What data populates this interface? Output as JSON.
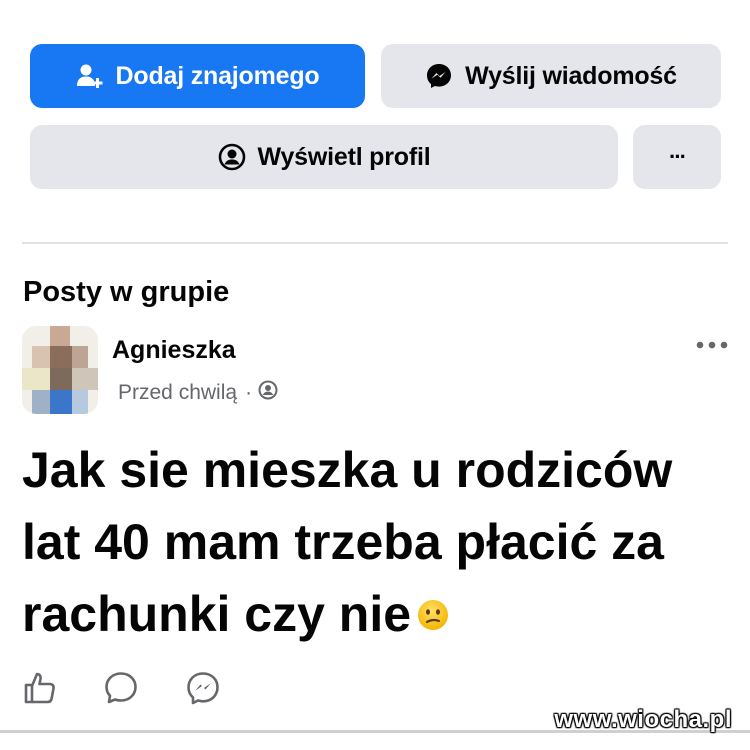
{
  "profile_actions": {
    "add_friend_label": "Dodaj znajomego",
    "message_label": "Wyślij wiadomość",
    "view_profile_label": "Wyświetl profil",
    "more_label": "···"
  },
  "section": {
    "title": "Posty w grupie"
  },
  "post": {
    "author": "Agnieszka",
    "time": "Przed chwilą",
    "separator": "·",
    "text": "Jak sie mieszka u rodziców lat 40 mam trzeba płacić za rachunki czy nie",
    "emoji": "confused-face-emoji"
  },
  "actions": {
    "like": "like-icon",
    "comment": "comment-icon",
    "share": "messenger-share-icon"
  },
  "watermark": "www.wiocha.pl",
  "colors": {
    "primary": "#1877f2",
    "secondary_button": "#e4e6eb",
    "text": "#050505",
    "muted": "#65676b"
  }
}
